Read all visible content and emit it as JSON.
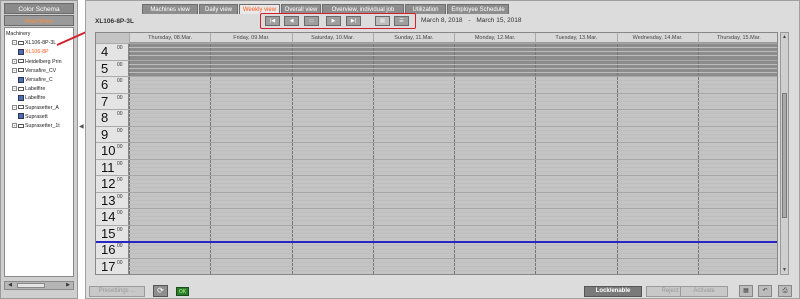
{
  "left_panel": {
    "color_schema_label": "Color Schema",
    "machines_label": "Machines",
    "tree": [
      {
        "label": "Machinery",
        "indent": 0,
        "toggle": "",
        "icon": "none",
        "selected": false
      },
      {
        "label": "XL106-8P-3L",
        "indent": 1,
        "toggle": "−",
        "icon": "folder",
        "selected": false
      },
      {
        "label": "XL106-8P",
        "indent": 2,
        "toggle": "",
        "icon": "machine",
        "selected": true
      },
      {
        "label": "Heidelberg Prin",
        "indent": 1,
        "toggle": "+",
        "icon": "folder",
        "selected": false
      },
      {
        "label": "Versafire_CV",
        "indent": 1,
        "toggle": "−",
        "icon": "folder",
        "selected": false
      },
      {
        "label": "Versafire_C",
        "indent": 2,
        "toggle": "",
        "icon": "machine",
        "selected": false
      },
      {
        "label": "Labelfire",
        "indent": 1,
        "toggle": "−",
        "icon": "folder",
        "selected": false
      },
      {
        "label": "Labelfire",
        "indent": 2,
        "toggle": "",
        "icon": "machine",
        "selected": false
      },
      {
        "label": "Suprasetter_A",
        "indent": 1,
        "toggle": "−",
        "icon": "folder",
        "selected": false
      },
      {
        "label": "Suprasett",
        "indent": 2,
        "toggle": "",
        "icon": "machine",
        "selected": false
      },
      {
        "label": "Suprasetter_1t",
        "indent": 1,
        "toggle": "+",
        "icon": "folder",
        "selected": false
      }
    ]
  },
  "tabs": [
    {
      "label": "Machines view",
      "active": false
    },
    {
      "label": "Daily view",
      "active": false
    },
    {
      "label": "Weekly view",
      "active": true
    },
    {
      "label": "Overall view",
      "active": false
    },
    {
      "label": "Overview, individual job",
      "active": false
    },
    {
      "label": "Utilization",
      "active": false
    },
    {
      "label": "Employee Schedule",
      "active": false
    }
  ],
  "machine_title": "XL106-8P-3L",
  "date_range": {
    "start": "March 8, 2018",
    "separator": "-",
    "end": "March 15, 2018"
  },
  "days": [
    "Thursday, 08.Mar.",
    "Friday, 09.Mar.",
    "Saturday, 10.Mar.",
    "Sunday, 11.Mar.",
    "Monday, 12.Mar.",
    "Tuesday, 13.Mar.",
    "Wednesday, 14.Mar.",
    "Thursday, 15.Mar."
  ],
  "hours": [
    "4",
    "5",
    "6",
    "7",
    "8",
    "9",
    "10",
    "11",
    "12",
    "13",
    "14",
    "15",
    "16",
    "17"
  ],
  "minutes_label": "00",
  "bottom_bar": {
    "presettings_label": "Presettings ...",
    "ok_label": "OK",
    "lock_enable_label": "Lock/enable",
    "reject_label": "Reject",
    "activate_label": "Activate"
  },
  "colors": {
    "accent": "#ff5a1f",
    "annotation_red": "#d0212a",
    "now_line": "#2525c8",
    "blocked": "#8c8c8c"
  }
}
